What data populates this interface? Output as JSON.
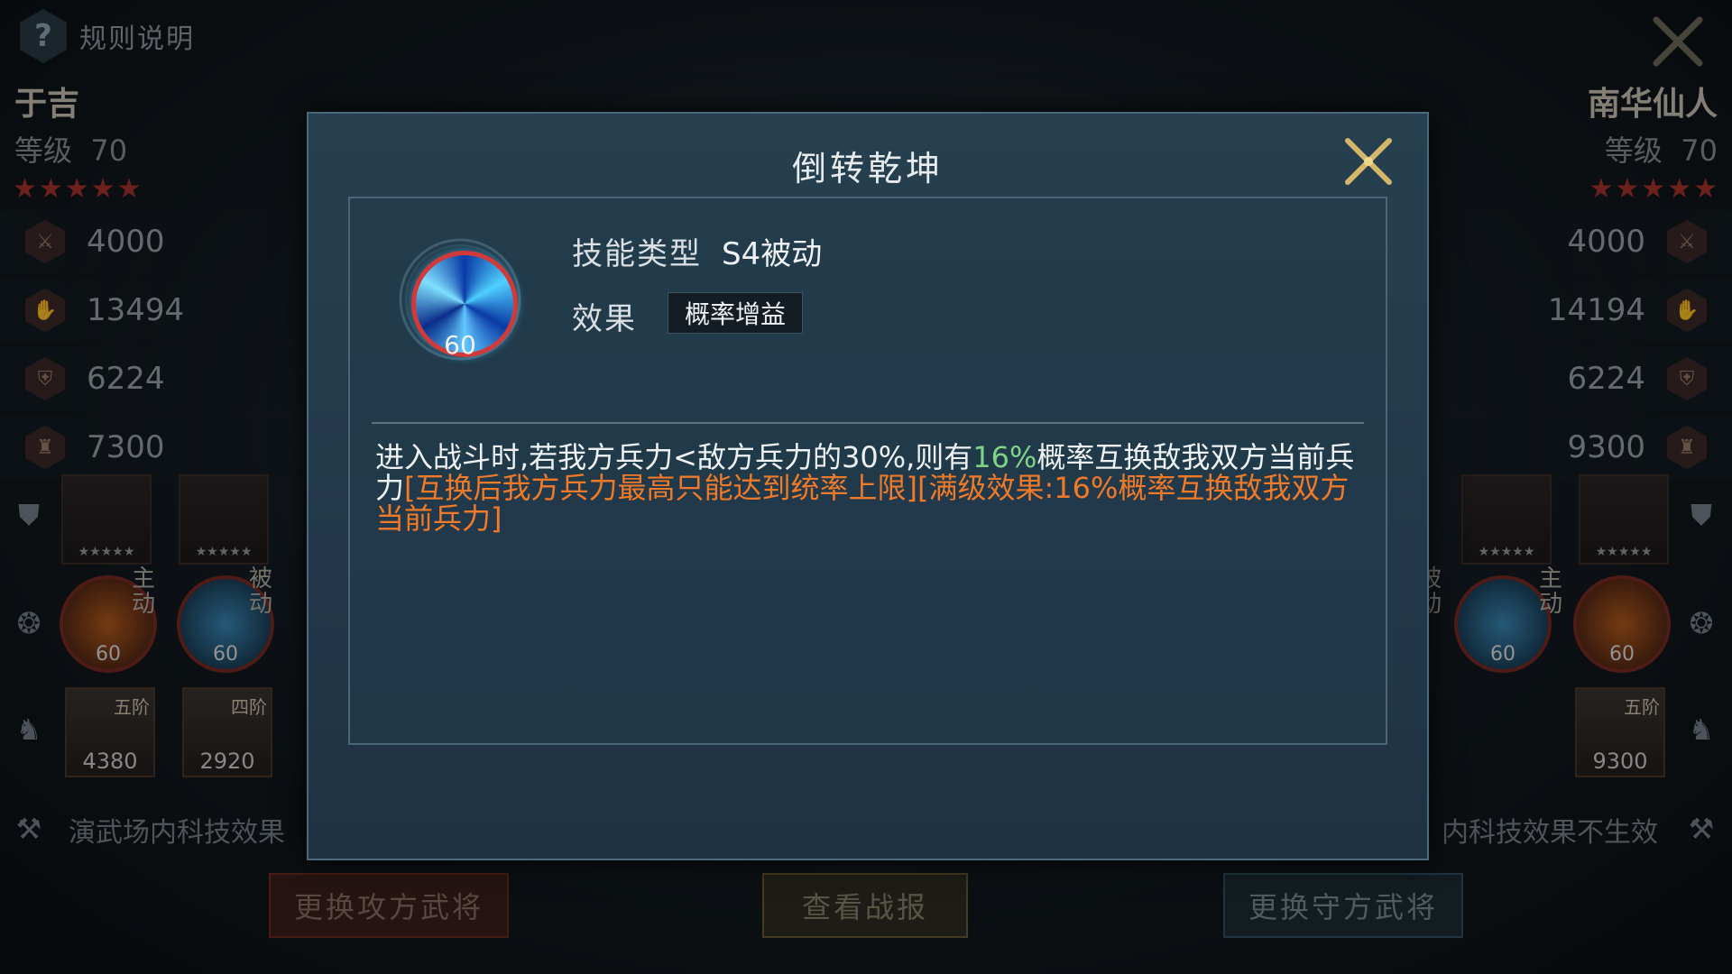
{
  "header": {
    "rules_label": "规则说明",
    "help_icon": "?"
  },
  "attacker": {
    "name": "于吉",
    "level_label": "等级",
    "level": "70",
    "stars": "★★★★★",
    "stats": [
      "4000",
      "13494",
      "6224",
      "7300"
    ],
    "skill_level": "60",
    "skill2_level": "60",
    "skill_tag_1": "主动",
    "skill_tag_2": "被动",
    "troops": [
      {
        "rank": "五阶",
        "count": "4380"
      },
      {
        "rank": "四阶",
        "count": "2920"
      }
    ],
    "tech_note": "演武场内科技效果"
  },
  "defender": {
    "name": "南华仙人",
    "level_label": "等级",
    "level": "70",
    "stars": "★★★★★",
    "stats": [
      "4000",
      "14194",
      "6224",
      "9300"
    ],
    "skill_level": "60",
    "skill2_level": "60",
    "skill_tag_1": "被动",
    "skill_tag_2": "主动",
    "troops": [
      {
        "rank": "五阶",
        "count": "9300"
      }
    ],
    "tech_note": "内科技效果不生效"
  },
  "card_stars": "★★★★★",
  "buttons": {
    "attack": "更换攻方武将",
    "report": "查看战报",
    "defend": "更换守方武将"
  },
  "modal": {
    "title": "倒转乾坤",
    "skill_level": "60",
    "type_label": "技能类型",
    "type_value": "S4被动",
    "effect_label": "效果",
    "effect_value": "概率增益",
    "desc_part1": "进入战斗时,若我方兵力<敌方兵力的30%,则有",
    "desc_highlight": "16%",
    "desc_part2": "概率互换敌我双方当前兵力",
    "desc_orange": "[互换后我方兵力最高只能达到统率上限][满级效果:16%概率互换敌我双方当前兵力]"
  },
  "colors": {
    "highlight_green": "#7ed386",
    "note_orange": "#f07a28",
    "star_red": "#a8322b"
  }
}
